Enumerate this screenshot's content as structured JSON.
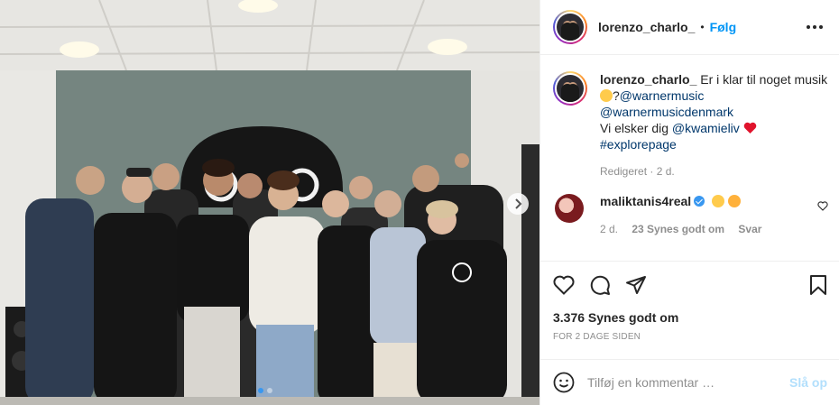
{
  "post": {
    "username": "lorenzo_charlo_",
    "separator": "•",
    "follow_label": "Følg",
    "caption": {
      "username": "lorenzo_charlo_",
      "text1": "Er i klar til noget musik",
      "text2": "?",
      "mention1": "@warnermusic",
      "mention2": "@warnermusicdenmark",
      "text3": "Vi elsker dig",
      "mention3": "@kwamieliv",
      "hashtag": "#explorepage",
      "meta": "Redigeret · 2 d."
    },
    "comment": {
      "username": "maliktanis4real",
      "time": "2 d.",
      "likes": "23 Synes godt om",
      "reply": "Svar"
    },
    "likes": "3.376 Synes godt om",
    "time_ago": "FOR 2 DAGE SIDEN",
    "add_comment_placeholder": "Tilføj en kommentar …",
    "post_button": "Slå op",
    "colors": {
      "follow": "#0095f6",
      "link": "#00376b",
      "muted": "#8e8e8e",
      "post_disabled": "#b2dffc",
      "heart": "#ed4956"
    }
  }
}
